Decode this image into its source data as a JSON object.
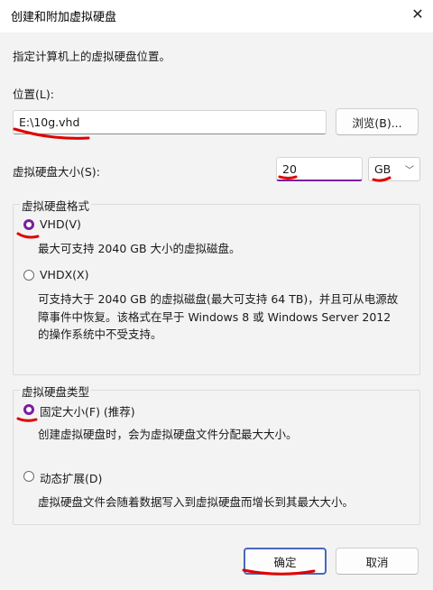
{
  "window": {
    "title": "创建和附加虚拟硬盘",
    "close_icon": "close-icon"
  },
  "intro": "指定计算机上的虚拟硬盘位置。",
  "location": {
    "label": "位置(L):",
    "value": "E:\\10g.vhd",
    "browse_label": "浏览(B)..."
  },
  "size": {
    "label": "虚拟硬盘大小(S):",
    "value": "20",
    "unit": "GB"
  },
  "format": {
    "group_title": "虚拟硬盘格式",
    "vhd": {
      "label": "VHD(V)",
      "checked": true,
      "desc": "最大可支持 2040 GB 大小的虚拟磁盘。"
    },
    "vhdx": {
      "label": "VHDX(X)",
      "checked": false,
      "desc_lines": [
        "可支持大于 2040 GB 的虚拟磁盘(最大可支持 64 TB)，并且可从电源故",
        "障事件中恢复。该格式在早于 Windows 8 或 Windows Server 2012",
        "的操作系统中不受支持。"
      ]
    }
  },
  "type": {
    "group_title": "虚拟硬盘类型",
    "fixed": {
      "label": "固定大小(F) (推荐)",
      "checked": true,
      "desc": "创建虚拟硬盘时，会为虚拟硬盘文件分配最大大小。"
    },
    "dynamic": {
      "label": "动态扩展(D)",
      "checked": false,
      "desc": "虚拟硬盘文件会随着数据写入到虚拟硬盘而增长到其最大大小。"
    }
  },
  "footer": {
    "ok_label": "确定",
    "cancel_label": "取消"
  },
  "colors": {
    "annotation_red": "#e00000",
    "accent": "#7a1ea0"
  }
}
